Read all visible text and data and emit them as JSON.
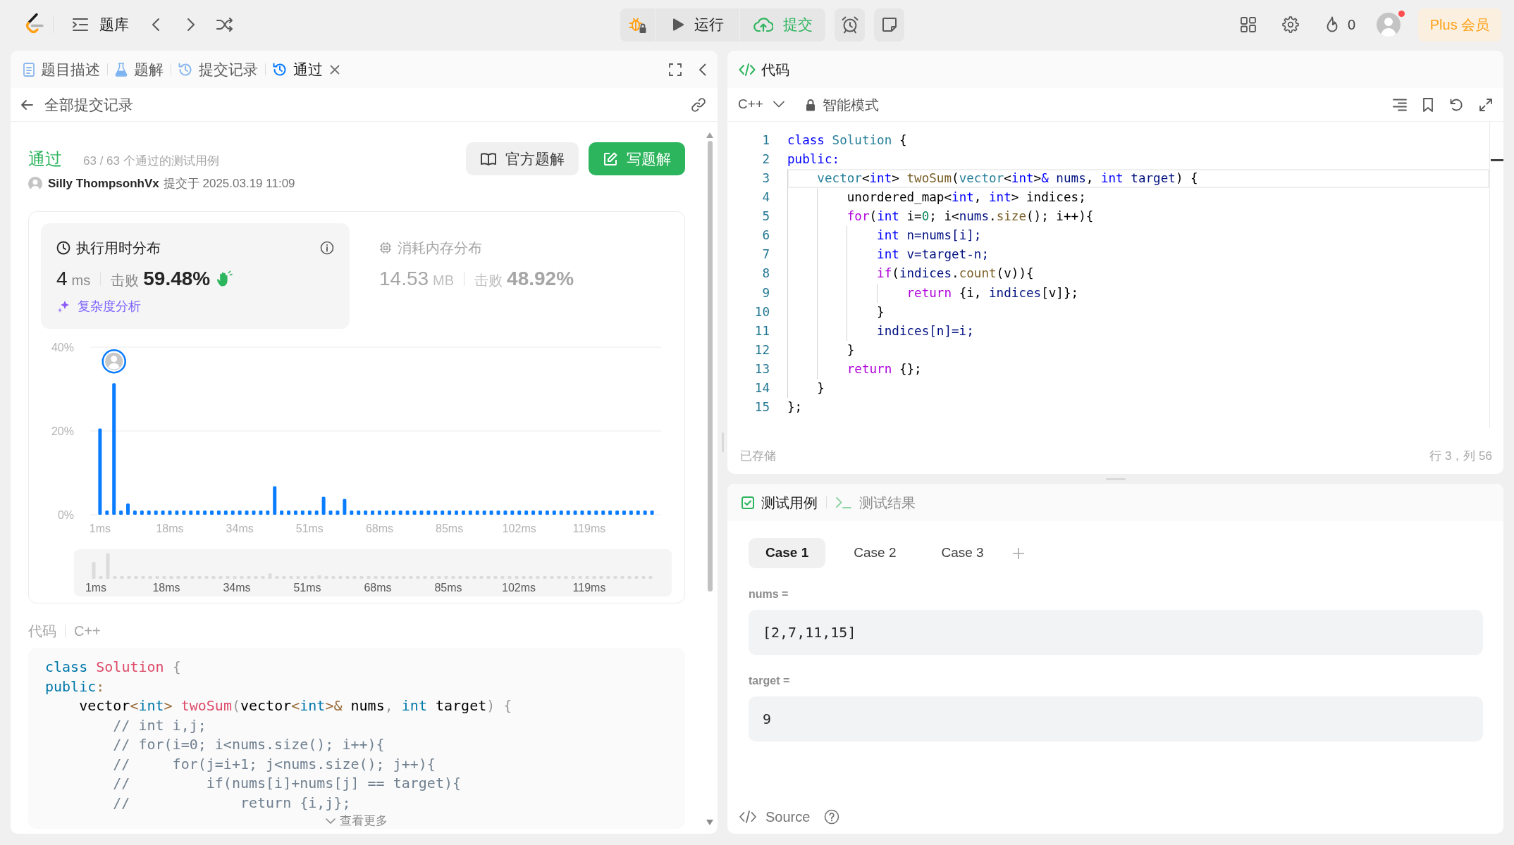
{
  "topbar": {
    "problem_list": "题库",
    "run": "运行",
    "submit": "提交",
    "streak": "0",
    "has_notification": true,
    "plus": "Plus 会员"
  },
  "left_panel": {
    "tabs": [
      {
        "label": "题目描述",
        "kind": "description",
        "selected": false,
        "closable": false
      },
      {
        "label": "题解",
        "kind": "solutions",
        "selected": false,
        "closable": false
      },
      {
        "label": "提交记录",
        "kind": "history",
        "selected": false,
        "closable": false
      },
      {
        "label": "通过",
        "kind": "history",
        "selected": true,
        "closable": true
      }
    ],
    "back_link": "全部提交记录",
    "result": {
      "status": "通过",
      "cases": "63 / 63 个通过的测试用例",
      "user": "Silly ThompsonhVx",
      "submitted": "提交于 2025.03.19 11:09"
    },
    "buttons": [
      {
        "label": "官方题解",
        "kind": "secondary"
      },
      {
        "label": "写题解",
        "kind": "primary"
      }
    ],
    "stats": [
      {
        "kind": "runtime",
        "title": "执行用时分布",
        "selected": true,
        "value": "4",
        "unit": "ms",
        "beats_label": "击败",
        "beats": "59.48%",
        "celebrate": true,
        "link": "复杂度分析"
      },
      {
        "kind": "memory",
        "title": "消耗内存分布",
        "selected": false,
        "value": "14.53",
        "unit": "MB",
        "beats_label": "击败",
        "beats": "48.92%",
        "celebrate": false
      }
    ],
    "chart_data": {
      "type": "bar",
      "categories": [
        "1ms",
        null,
        null,
        null,
        null,
        null,
        null,
        null,
        null,
        null,
        "18ms",
        null,
        null,
        null,
        null,
        null,
        null,
        null,
        null,
        null,
        "34ms",
        null,
        null,
        null,
        null,
        null,
        null,
        null,
        null,
        null,
        "51ms",
        null,
        null,
        null,
        null,
        null,
        null,
        null,
        null,
        null,
        "68ms",
        null,
        null,
        null,
        null,
        null,
        null,
        null,
        null,
        null,
        "85ms",
        null,
        null,
        null,
        null,
        null,
        null,
        null,
        null,
        null,
        "102ms",
        null,
        null,
        null,
        null,
        null,
        null,
        null,
        null,
        null,
        "119ms",
        null,
        null,
        null,
        null,
        null,
        null,
        null,
        null,
        null
      ],
      "values": [
        20.6,
        1,
        31.4,
        1,
        2.7,
        1,
        1,
        1,
        1,
        1,
        1,
        1,
        1,
        1,
        1,
        1,
        1,
        1,
        1,
        1,
        1,
        1,
        1,
        1,
        1,
        6.8,
        1,
        1,
        1,
        1,
        1,
        1,
        4.3,
        1,
        1,
        3.8,
        1,
        1,
        1,
        1,
        1,
        1,
        1,
        1,
        1,
        1,
        1,
        1,
        1,
        1,
        1,
        1,
        1,
        1,
        1,
        1,
        1,
        1,
        1,
        1,
        1,
        1,
        1,
        1,
        1,
        1,
        1,
        1,
        1,
        1,
        1,
        1,
        1,
        1,
        1,
        1,
        1,
        1,
        1,
        1
      ],
      "ylim": [
        0,
        40
      ],
      "yticks": [
        {
          "value": 0,
          "label": "0%"
        },
        {
          "value": 20,
          "label": "20%"
        },
        {
          "value": 40,
          "label": "40%"
        }
      ]
    },
    "navigator": {
      "labels": [
        "1ms",
        "18ms",
        "34ms",
        "51ms",
        "68ms",
        "85ms",
        "102ms",
        "119ms"
      ]
    },
    "code_section": {
      "title": "代码",
      "language": "C++",
      "more": "查看更多"
    },
    "code": [
      [
        {
          "kind": "kw",
          "text": "class"
        },
        {
          "kind": "title",
          "text": " Solution"
        },
        {
          "kind": "punct",
          "text": " {"
        }
      ],
      [
        {
          "kind": "kw",
          "text": "public"
        },
        {
          "kind": "op",
          "text": ":"
        }
      ],
      [
        {
          "kind": "plain",
          "text": "    vector"
        },
        {
          "kind": "op",
          "text": "<"
        },
        {
          "kind": "kw",
          "text": "int"
        },
        {
          "kind": "op",
          "text": ">"
        },
        {
          "kind": "title",
          "text": " twoSum"
        },
        {
          "kind": "punct",
          "text": "("
        },
        {
          "kind": "plain",
          "text": "vector"
        },
        {
          "kind": "op",
          "text": "<"
        },
        {
          "kind": "kw",
          "text": "int"
        },
        {
          "kind": "op",
          "text": ">&"
        },
        {
          "kind": "plain",
          "text": " nums"
        },
        {
          "kind": "punct",
          "text": ","
        },
        {
          "kind": "kw",
          "text": " int"
        },
        {
          "kind": "plain",
          "text": " target"
        },
        {
          "kind": "punct",
          "text": ") {"
        }
      ],
      [
        {
          "kind": "comment",
          "text": "        // int i,j;"
        }
      ],
      [
        {
          "kind": "comment",
          "text": "        // for(i=0; i<nums.size(); i++){"
        }
      ],
      [
        {
          "kind": "comment",
          "text": "        //     for(j=i+1; j<nums.size(); j++){"
        }
      ],
      [
        {
          "kind": "comment",
          "text": "        //         if(nums[i]+nums[j] == target){"
        }
      ],
      [
        {
          "kind": "comment",
          "text": "        //             return {i,j};"
        }
      ]
    ]
  },
  "editor": {
    "title": "代码",
    "language": "C++",
    "mode": "智能模式",
    "lines": [
      {
        "number": "1",
        "current": false,
        "tokens": [
          {
            "kind": "kw",
            "text": "class"
          },
          {
            "kind": "type",
            "text": " Solution"
          },
          {
            "kind": "plain",
            "text": " {"
          }
        ]
      },
      {
        "number": "2",
        "current": false,
        "tokens": [
          {
            "kind": "kw",
            "text": "public:"
          }
        ]
      },
      {
        "number": "3",
        "current": true,
        "tokens": [
          {
            "kind": "type",
            "text": "    vector"
          },
          {
            "kind": "plain",
            "text": "<"
          },
          {
            "kind": "kw",
            "text": "int"
          },
          {
            "kind": "plain",
            "text": "> "
          },
          {
            "kind": "fn",
            "text": "twoSum"
          },
          {
            "kind": "plain",
            "text": "("
          },
          {
            "kind": "type",
            "text": "vector"
          },
          {
            "kind": "plain",
            "text": "<"
          },
          {
            "kind": "kw",
            "text": "int"
          },
          {
            "kind": "plain",
            "text": ">"
          },
          {
            "kind": "kw",
            "text": "&"
          },
          {
            "kind": "var",
            "text": " nums"
          },
          {
            "kind": "plain",
            "text": ", "
          },
          {
            "kind": "kw",
            "text": "int"
          },
          {
            "kind": "var",
            "text": " target"
          },
          {
            "kind": "plain",
            "text": ") {"
          }
        ]
      },
      {
        "number": "4",
        "current": false,
        "tokens": [
          {
            "kind": "plain",
            "text": "        unordered_map<"
          },
          {
            "kind": "kw",
            "text": "int"
          },
          {
            "kind": "plain",
            "text": ", "
          },
          {
            "kind": "kw",
            "text": "int"
          },
          {
            "kind": "plain",
            "text": "> indices;"
          }
        ]
      },
      {
        "number": "5",
        "current": false,
        "tokens": [
          {
            "kind": "ctrl",
            "text": "        for"
          },
          {
            "kind": "plain",
            "text": "("
          },
          {
            "kind": "kw",
            "text": "int"
          },
          {
            "kind": "plain",
            "text": " i="
          },
          {
            "kind": "num",
            "text": "0"
          },
          {
            "kind": "plain",
            "text": "; i<"
          },
          {
            "kind": "var",
            "text": "nums"
          },
          {
            "kind": "plain",
            "text": "."
          },
          {
            "kind": "fn",
            "text": "size"
          },
          {
            "kind": "plain",
            "text": "(); i++){"
          }
        ]
      },
      {
        "number": "6",
        "current": false,
        "tokens": [
          {
            "kind": "kw",
            "text": "            int"
          },
          {
            "kind": "var",
            "text": " n=nums[i];"
          }
        ]
      },
      {
        "number": "7",
        "current": false,
        "tokens": [
          {
            "kind": "kw",
            "text": "            int"
          },
          {
            "kind": "var",
            "text": " v=target-n;"
          }
        ]
      },
      {
        "number": "8",
        "current": false,
        "tokens": [
          {
            "kind": "ctrl",
            "text": "            if"
          },
          {
            "kind": "plain",
            "text": "("
          },
          {
            "kind": "var",
            "text": "indices"
          },
          {
            "kind": "plain",
            "text": "."
          },
          {
            "kind": "fn",
            "text": "count"
          },
          {
            "kind": "plain",
            "text": "(v)){"
          }
        ]
      },
      {
        "number": "9",
        "current": false,
        "tokens": [
          {
            "kind": "ctrl",
            "text": "                return"
          },
          {
            "kind": "plain",
            "text": " {i, "
          },
          {
            "kind": "var",
            "text": "indices"
          },
          {
            "kind": "plain",
            "text": "[v]};"
          }
        ]
      },
      {
        "number": "10",
        "current": false,
        "tokens": [
          {
            "kind": "plain",
            "text": "            }"
          }
        ]
      },
      {
        "number": "11",
        "current": false,
        "tokens": [
          {
            "kind": "var",
            "text": "            indices[n]=i;"
          }
        ]
      },
      {
        "number": "12",
        "current": false,
        "tokens": [
          {
            "kind": "plain",
            "text": "        }"
          }
        ]
      },
      {
        "number": "13",
        "current": false,
        "tokens": [
          {
            "kind": "ctrl",
            "text": "        return"
          },
          {
            "kind": "plain",
            "text": " {};"
          }
        ]
      },
      {
        "number": "14",
        "current": false,
        "tokens": [
          {
            "kind": "plain",
            "text": "    }"
          }
        ]
      },
      {
        "number": "15",
        "current": false,
        "tokens": [
          {
            "kind": "plain",
            "text": "};"
          }
        ]
      }
    ],
    "saved": "已存储",
    "cursor": "行 3，列 56"
  },
  "testcase": {
    "tabs": [
      {
        "label": "测试用例",
        "kind": "testcase",
        "selected": true
      },
      {
        "label": "测试结果",
        "kind": "result",
        "selected": false
      }
    ],
    "cases": [
      {
        "label": "Case 1",
        "selected": true
      },
      {
        "label": "Case 2",
        "selected": false
      },
      {
        "label": "Case 3",
        "selected": false
      }
    ],
    "inputs": [
      {
        "label": "nums =",
        "value": "[2,7,11,15]"
      },
      {
        "label": "target =",
        "value": "9"
      }
    ],
    "source": "Source"
  }
}
